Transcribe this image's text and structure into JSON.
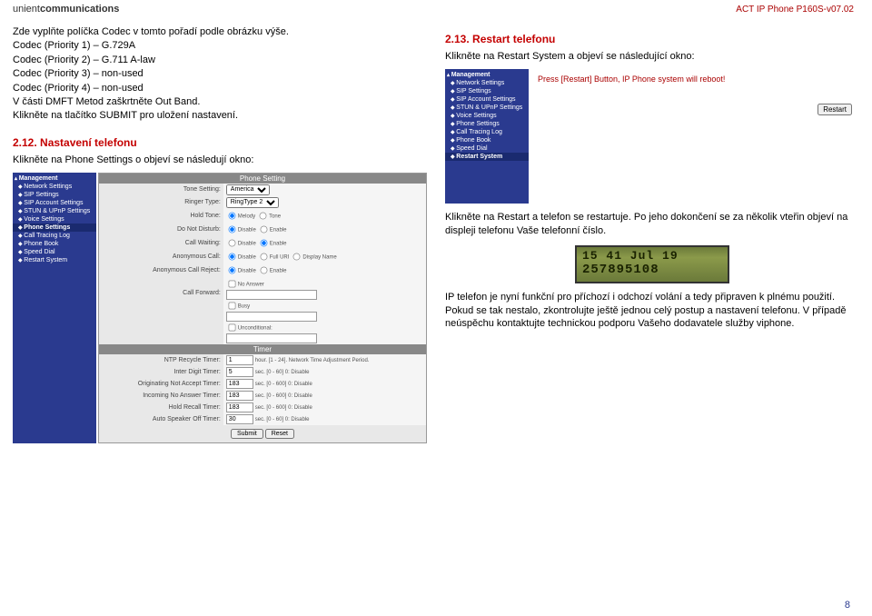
{
  "header": {
    "brand_prefix": "unient",
    "brand_suffix": "communications",
    "model": "ACT IP Phone P160S-v07.02"
  },
  "left": {
    "intro_lines": [
      "Zde vyplňte políčka Codec v tomto pořadí podle obrázku výše.",
      "Codec (Priority 1) – G.729A",
      "Codec (Priority 2) – G.711 A-law",
      "Codec (Priority 3) – non-used",
      "Codec (Priority 4) – non-used",
      "V části DMFT Metod zaškrtněte Out Band.",
      "Klikněte na tlačítko SUBMIT pro uložení nastavení."
    ],
    "heading": "2.12. Nastavení telefonu",
    "sub": "Klikněte na Phone Settings o objeví se následují okno:",
    "sidebar": [
      "Management",
      "Network Settings",
      "SIP Settings",
      "SIP Account Settings",
      "STUN & UPnP Settings",
      "Voice Settings",
      "Phone Settings",
      "Call Tracing Log",
      "Phone Book",
      "Speed Dial",
      "Restart System"
    ],
    "phone_panel": {
      "title": "Phone Setting",
      "tone_setting": {
        "label": "Tone Setting:",
        "value": "America"
      },
      "ringer_type": {
        "label": "Ringer Type:",
        "value": "RingType 2"
      },
      "hold_tone": {
        "label": "Hold Tone:",
        "opts": [
          "Melody",
          "Tone"
        ]
      },
      "dnd": {
        "label": "Do Not Disturb:",
        "opts": [
          "Disable",
          "Enable"
        ]
      },
      "call_waiting": {
        "label": "Call Waiting:",
        "opts": [
          "Disable",
          "Enable"
        ]
      },
      "anon_call": {
        "label": "Anonymous Call:",
        "opts": [
          "Disable",
          "Full URI",
          "Display Name"
        ]
      },
      "anon_reject": {
        "label": "Anonymous Call Reject:",
        "opts": [
          "Disable",
          "Enable"
        ]
      },
      "call_forward": {
        "label": "Call Forward:",
        "opts": [
          "No Answer",
          "Busy",
          "Unconditional:"
        ]
      }
    },
    "timer_panel": {
      "title": "Timer",
      "rows": [
        {
          "label": "NTP Recycle Timer:",
          "val": "1",
          "suffix": "hour. [1 - 24]. Network Time Adjustment Period."
        },
        {
          "label": "Inter Digit Timer:",
          "val": "5",
          "suffix": "sec. [0 - 60] 0: Disable"
        },
        {
          "label": "Originating Not Accept Timer:",
          "val": "183",
          "suffix": "sec. [0 - 600] 0: Disable"
        },
        {
          "label": "Incoming No Answer Timer:",
          "val": "183",
          "suffix": "sec. [0 - 600] 0: Disable"
        },
        {
          "label": "Hold Recall Timer:",
          "val": "183",
          "suffix": "sec. [0 - 600] 0: Disable"
        },
        {
          "label": "Auto Speaker Off Timer:",
          "val": "30",
          "suffix": "sec. [0 - 60] 0: Disable"
        }
      ],
      "buttons": [
        "Submit",
        "Reset"
      ]
    }
  },
  "right": {
    "heading": "2.13. Restart telefonu",
    "sub": "Klikněte na Restart System a objeví se následující okno:",
    "sidebar": [
      "Management",
      "Network Settings",
      "SIP Settings",
      "SIP Account Settings",
      "STUN & UPnP Settings",
      "Voice Settings",
      "Phone Settings",
      "Call Tracing Log",
      "Phone Book",
      "Speed Dial",
      "Restart System"
    ],
    "restart_msg": "Press [Restart] Button, IP Phone system will reboot!",
    "restart_btn": "Restart",
    "para1": "Klikněte na Restart a telefon se restartuje. Po jeho dokončení se za několik vteřin objeví na displeji telefonu Vaše telefonní číslo.",
    "lcd": {
      "line1": "15 41   Jul 19",
      "line2": "257895108"
    },
    "para2": "IP telefon je nyní funkční pro příchozí i odchozí volání a tedy připraven k plnému použití. Pokud se tak nestalo, zkontrolujte ještě jednou celý postup a nastavení telefonu. V případě neúspěchu kontaktujte technickou podporu Vašeho dodavatele služby viphone."
  },
  "page": "8"
}
